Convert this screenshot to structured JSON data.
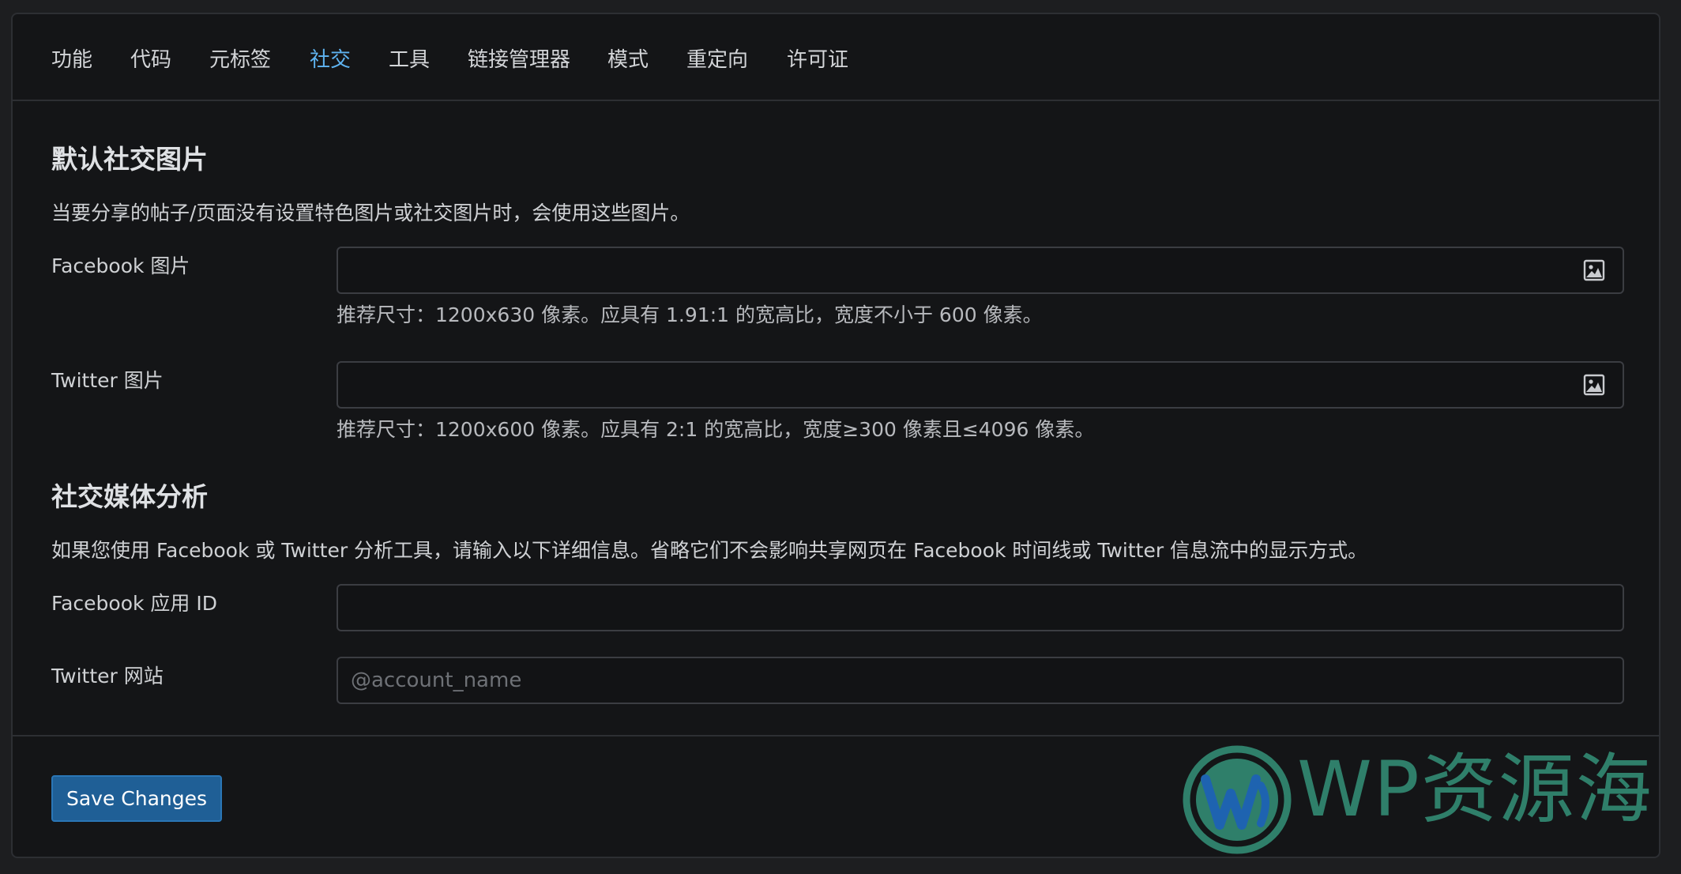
{
  "tabs": [
    {
      "label": "功能",
      "active": false
    },
    {
      "label": "代码",
      "active": false
    },
    {
      "label": "元标签",
      "active": false
    },
    {
      "label": "社交",
      "active": true
    },
    {
      "label": "工具",
      "active": false
    },
    {
      "label": "链接管理器",
      "active": false
    },
    {
      "label": "模式",
      "active": false
    },
    {
      "label": "重定向",
      "active": false
    },
    {
      "label": "许可证",
      "active": false
    }
  ],
  "default_images": {
    "title": "默认社交图片",
    "description": "当要分享的帖子/页面没有设置特色图片或社交图片时，会使用这些图片。",
    "facebook": {
      "label": "Facebook 图片",
      "value": "",
      "help": "推荐尺寸：1200x630 像素。应具有 1.91:1 的宽高比，宽度不小于 600 像素。"
    },
    "twitter": {
      "label": "Twitter 图片",
      "value": "",
      "help": "推荐尺寸：1200x600 像素。应具有 2:1 的宽高比，宽度≥300 像素且≤4096 像素。"
    }
  },
  "analytics": {
    "title": "社交媒体分析",
    "description": "如果您使用 Facebook 或 Twitter 分析工具，请输入以下详细信息。省略它们不会影响共享网页在 Facebook 时间线或 Twitter 信息流中的显示方式。",
    "facebook_app_id": {
      "label": "Facebook 应用 ID",
      "value": ""
    },
    "twitter_site": {
      "label": "Twitter 网站",
      "value": "",
      "placeholder": "@account_name"
    }
  },
  "footer": {
    "save_label": "Save Changes"
  },
  "watermark": {
    "text": "WP资源海"
  },
  "colors": {
    "accent": "#5fb4f2",
    "button": "#1f5f96",
    "background": "#141517",
    "watermark_green": "#2f7f6a",
    "watermark_blue": "#1e63b0"
  },
  "icons": {
    "image_picker": "image-icon",
    "logo": "wordpress-logo"
  }
}
